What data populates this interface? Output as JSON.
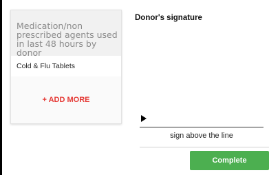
{
  "medications": {
    "header": "Medication/non prescribed agents used in last 48 hours by donor",
    "items": [
      {
        "label": "Cold & Flu Tablets"
      }
    ],
    "add_more_label": "+ ADD MORE"
  },
  "signature": {
    "title": "Donor's signature",
    "hint": "sign above the line"
  },
  "actions": {
    "complete_label": "Complete"
  },
  "colors": {
    "add_more": "#e53935",
    "complete_button": "#4caf50",
    "card_header_bg": "#f1f1f1"
  }
}
